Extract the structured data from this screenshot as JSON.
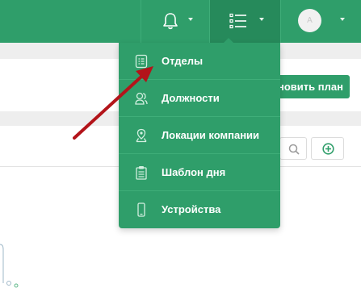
{
  "header": {
    "notifications_icon": "bell-icon",
    "menu_icon": "list-icon",
    "user_avatar_letter": "A",
    "caret_icon": "chevron-down-icon"
  },
  "toolbar": {
    "update_plan_label": "новить план",
    "search_icon": "search-icon",
    "add_icon": "plus-circle-icon"
  },
  "dropdown": {
    "items": [
      {
        "label": "Отделы",
        "icon": "document-list-icon"
      },
      {
        "label": "Должности",
        "icon": "users-icon"
      },
      {
        "label": "Локации компании",
        "icon": "location-pin-icon"
      },
      {
        "label": "Шаблон дня",
        "icon": "clipboard-icon"
      },
      {
        "label": "Устройства",
        "icon": "mobile-device-icon"
      }
    ]
  },
  "colors": {
    "brand_green": "#2f9e6a",
    "brand_green_dark": "#268a5b",
    "annotation_arrow": "#b3141a"
  }
}
